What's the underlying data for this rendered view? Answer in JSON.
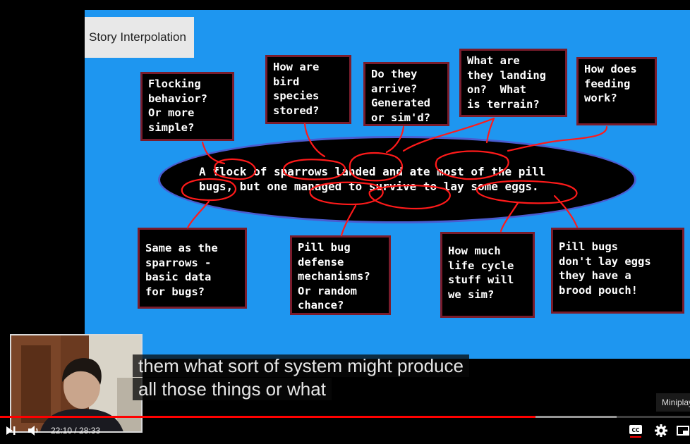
{
  "slide": {
    "title": "Story Interpolation",
    "story": "A flock of sparrows landed and ate most of the pill\nbugs, but one managed to survive to lay some eggs.",
    "top_boxes": [
      "Flocking\nbehavior?\nOr more\nsimple?",
      "How are\nbird\nspecies\nstored?",
      "Do they\narrive?\nGenerated\nor sim'd?",
      "What are\nthey landing\non?  What\nis terrain?",
      "How does\nfeeding\nwork?"
    ],
    "bottom_boxes": [
      "Same as the\nsparrows -\nbasic data\nfor bugs?",
      "Pill bug\ndefense\nmechanisms?\nOr random\nchance?",
      "How much\nlife cycle\nstuff will\nwe sim?",
      "Pill bugs\ndon't lay eggs\nthey have a\nbrood pouch!"
    ]
  },
  "captions": {
    "line1": "them what sort of system might produce",
    "line2": "all those things or what"
  },
  "miniplayer_label": "Miniplayer",
  "player": {
    "current_time": "22:10",
    "separator": " / ",
    "duration": "28:33",
    "progress_fraction": 0.7765,
    "buffered_fraction": 0.894
  },
  "icons": {
    "next": "next-icon",
    "volume": "volume-icon",
    "cc": "cc-icon",
    "settings": "gear-icon",
    "miniplayer": "miniplayer-icon"
  },
  "colors": {
    "slide_background": "#1e96f0",
    "box_border": "#7a1c2c",
    "annotation_ink": "#ff1a1a",
    "progress": "#ff0000"
  }
}
